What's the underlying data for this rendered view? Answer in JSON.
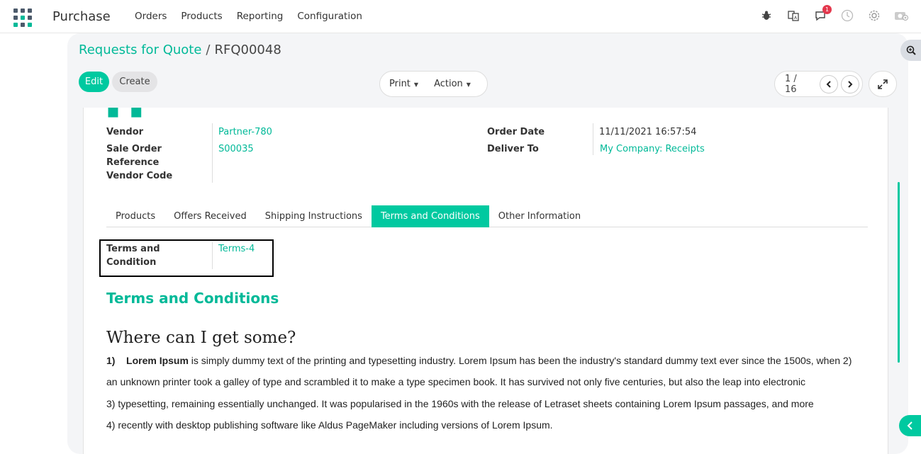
{
  "navbar": {
    "brand": "Purchase",
    "menu": [
      "Orders",
      "Products",
      "Reporting",
      "Configuration"
    ],
    "notification_count": "1",
    "icons": [
      "bug-icon",
      "translate-icon",
      "chat-icon",
      "clock-icon",
      "gear-icon",
      "camera-icon"
    ]
  },
  "breadcrumb": {
    "parent": "Requests for Quote",
    "separator": "/",
    "current": "RFQ00048"
  },
  "toolbar": {
    "edit_label": "Edit",
    "create_label": "Create",
    "print_label": "Print",
    "action_label": "Action",
    "pager": "1 / 16"
  },
  "form": {
    "vendor_label": "Vendor",
    "vendor_value": "Partner-780",
    "sale_order_label": "Sale Order Reference",
    "sale_order_value": "S00035",
    "vendor_code_label": "Vendor Code",
    "order_date_label": "Order Date",
    "order_date_value": "11/11/2021 16:57:54",
    "deliver_to_label": "Deliver To",
    "deliver_to_value": "My Company: Receipts"
  },
  "tabs": [
    "Products",
    "Offers Received",
    "Shipping Instructions",
    "Terms and Conditions",
    "Other Information"
  ],
  "active_tab": "Terms and Conditions",
  "terms": {
    "field_label": "Terms and Condition",
    "field_value": "Terms-4",
    "heading": "Terms and Conditions",
    "subheading": "Where can I get some?",
    "p1_num": "1)",
    "p1_bold": "Lorem Ipsum",
    "p1_rest": " is simply dummy text of the printing and typesetting industry. Lorem Ipsum has been the industry's standard dummy text ever since the 1500s, when 2)",
    "p2": "an unknown printer took a galley of type and scrambled it to make a type specimen book. It has survived not only five centuries, but also the leap into electronic",
    "p3": "3)  typesetting, remaining essentially unchanged. It was popularised in the 1960s with the release of Letraset sheets containing Lorem Ipsum passages, and more",
    "p4": "4)  recently with desktop publishing software like Aldus PageMaker including versions of Lorem Ipsum."
  },
  "colors": {
    "accent": "#00b998",
    "accent_button": "#00c9a0",
    "badge": "#e4384d"
  }
}
